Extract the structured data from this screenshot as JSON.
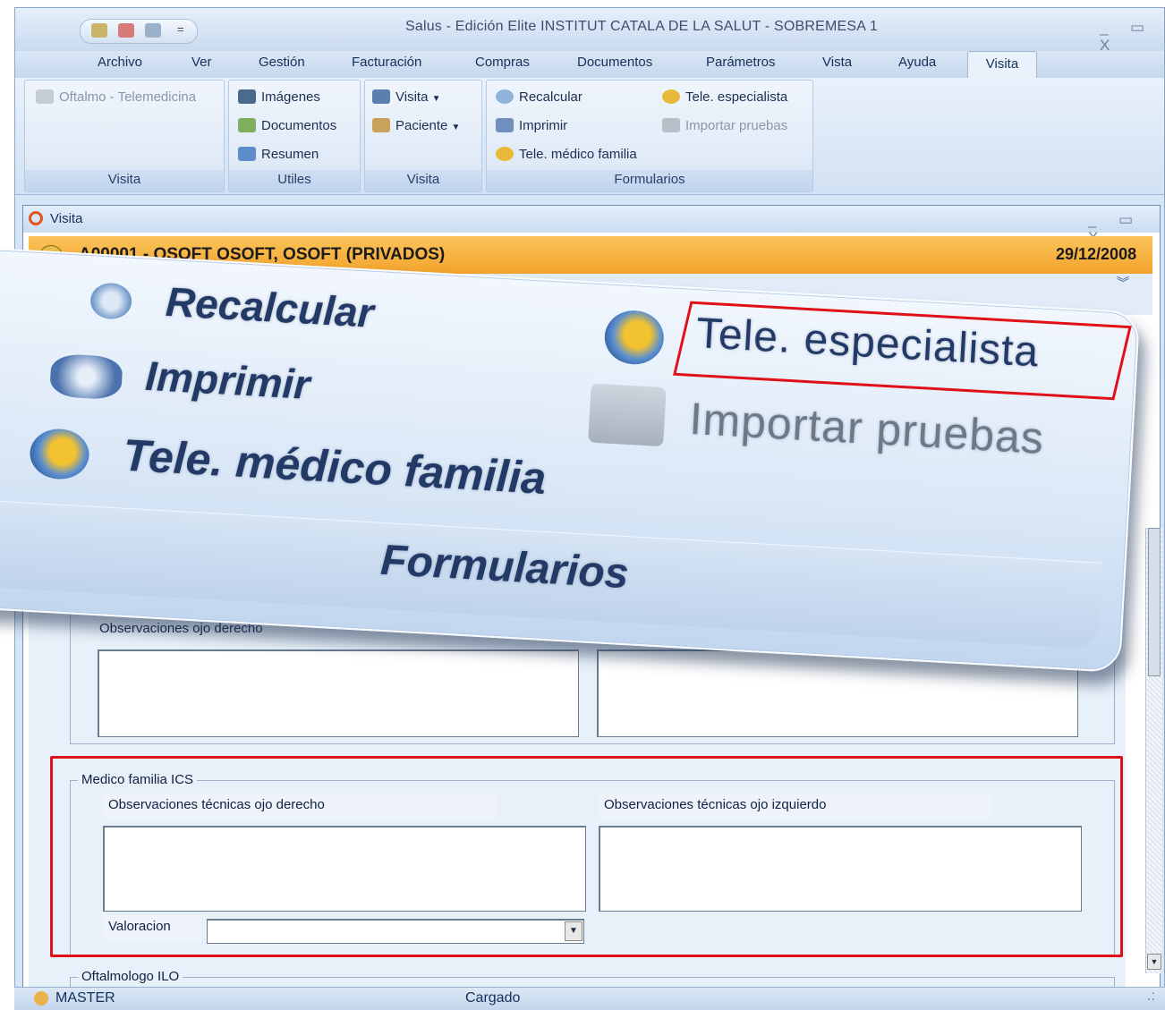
{
  "window": {
    "title": "Salus - Edición Elite INSTITUT CATALA DE LA SALUT - SOBREMESA 1",
    "controls": "_ ▭ X"
  },
  "menu": {
    "items": [
      "Archivo",
      "Ver",
      "Gestión",
      "Facturación",
      "Compras",
      "Documentos",
      "Parámetros",
      "Vista",
      "Ayuda",
      "Visita"
    ],
    "active": "Visita"
  },
  "ribbon": {
    "groups": [
      {
        "caption": "Visita",
        "items": [
          {
            "label": "Oftalmo - Telemedicina",
            "icon": "telemedicine-icon",
            "disabled": true
          }
        ]
      },
      {
        "caption": "Utiles",
        "items": [
          {
            "label": "Imágenes",
            "icon": "images-icon"
          },
          {
            "label": "Documentos",
            "icon": "documents-icon"
          },
          {
            "label": "Resumen",
            "icon": "summary-icon"
          }
        ]
      },
      {
        "caption": "Visita",
        "items": [
          {
            "label": "Visita",
            "icon": "visit-icon",
            "dropdown": true
          },
          {
            "label": "Paciente",
            "icon": "patient-icon",
            "dropdown": true
          }
        ]
      },
      {
        "caption": "Formularios",
        "items": [
          {
            "label": "Recalcular",
            "icon": "recalculate-icon"
          },
          {
            "label": "Tele. especialista",
            "icon": "tele-specialist-icon"
          },
          {
            "label": "Imprimir",
            "icon": "print-icon"
          },
          {
            "label": "Importar pruebas",
            "icon": "import-tests-icon",
            "disabled": true
          },
          {
            "label": "Tele. médico familia",
            "icon": "tele-family-doctor-icon"
          }
        ]
      }
    ]
  },
  "child_window": {
    "title": "Visita",
    "controls": "_ ▭ X",
    "patient_header": "A00001 - OSOFT OSOFT, OSOFT (PRIVADOS)",
    "date": "29/12/2008"
  },
  "form": {
    "upper_section": {
      "right_eye_label": "Observaciones ojo derecho"
    },
    "medico_familia": {
      "legend": "Medico familia ICS",
      "right_eye_label": "Observaciones técnicas ojo derecho",
      "left_eye_label": "Observaciones técnicas ojo izquierdo",
      "valoracion_label": "Valoracion",
      "valoracion_value": ""
    },
    "next_section_legend": "Oftalmologo ILO"
  },
  "status": {
    "user": "MASTER",
    "state": "Cargado",
    "grip": ".:"
  },
  "zoom_callout": {
    "recalcular": "Recalcular",
    "tele_especialista": "Tele. especialista",
    "imprimir": "Imprimir",
    "importar_pruebas": "Importar pruebas",
    "tele_medico_familia": "Tele. médico familia",
    "caption": "Formularios"
  },
  "colors": {
    "highlight": "#e10f18",
    "patient_bar": "#f3a32c",
    "ribbon": "#d2e1f3"
  }
}
